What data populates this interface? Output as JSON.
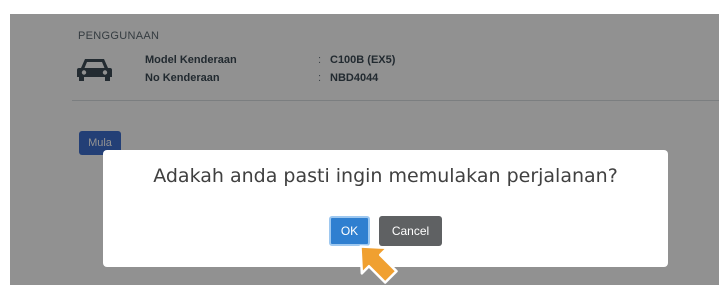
{
  "usage_section": {
    "title": "PENGGUNAAN",
    "icon": "car-icon",
    "rows": [
      {
        "label": "Model Kenderaan",
        "separator": ":",
        "value": "C100B (EX5)"
      },
      {
        "label": "No Kenderaan",
        "separator": ":",
        "value": "NBD4044"
      }
    ]
  },
  "start_button": {
    "label": "Mula"
  },
  "dialog": {
    "message": "Adakah anda pasti ingin memulakan perjalanan?",
    "ok_label": "OK",
    "cancel_label": "Cancel"
  },
  "colors": {
    "ok_button": "#2f7fd0",
    "cancel_button": "#5f6163",
    "start_button": "#3f6fd0",
    "pointer": "#f0a030"
  }
}
